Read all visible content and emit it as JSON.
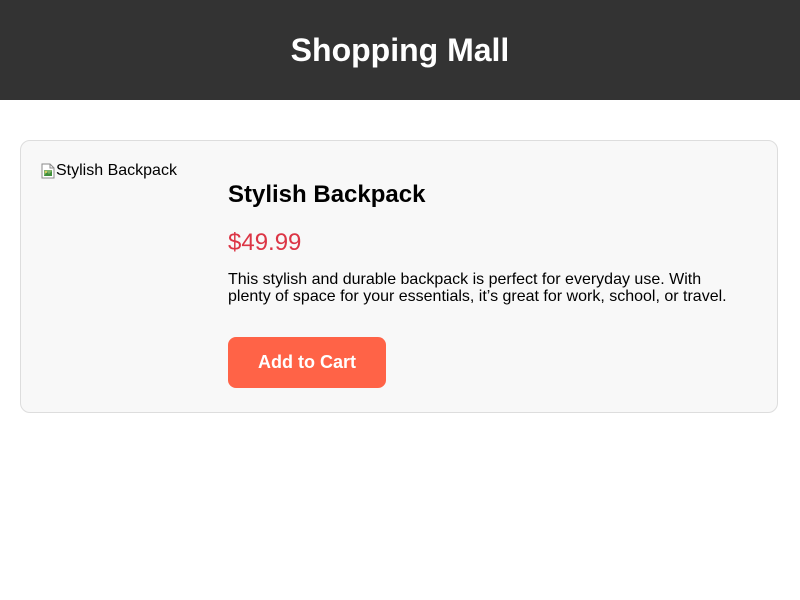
{
  "header": {
    "title": "Shopping Mall"
  },
  "product": {
    "image_alt": "Stylish Backpack",
    "image_icon": "broken-image-icon",
    "name": "Stylish Backpack",
    "price": "$49.99",
    "description": "This stylish and durable backpack is perfect for everyday use. With plenty of space for your essentials, it’s great for work, school, or travel.",
    "add_to_cart_label": "Add to Cart"
  },
  "colors": {
    "header_bg": "#333333",
    "card_bg": "#f8f8f8",
    "price": "#dc3545",
    "button_bg": "#ff6347"
  }
}
